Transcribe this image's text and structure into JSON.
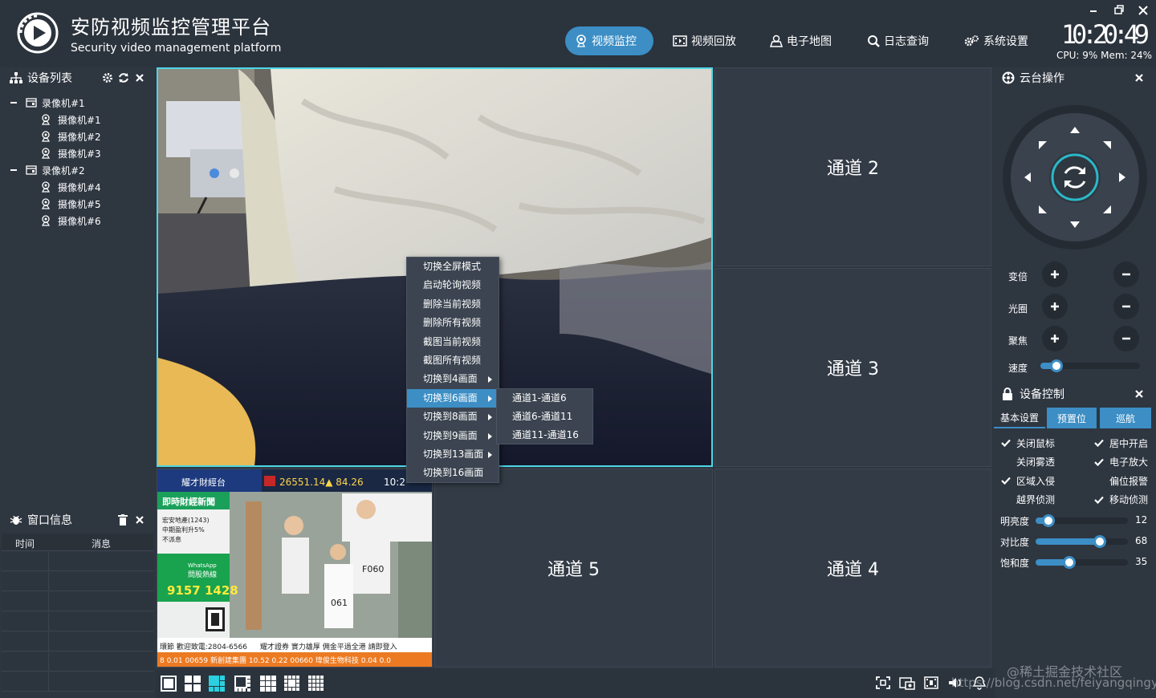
{
  "header": {
    "title": "安防视频监控管理平台",
    "subtitle": "Security video management platform",
    "nav": [
      {
        "label": "视频监控",
        "icon": "camera-icon",
        "active": true
      },
      {
        "label": "视频回放",
        "icon": "film-icon",
        "active": false
      },
      {
        "label": "电子地图",
        "icon": "user-map-icon",
        "active": false
      },
      {
        "label": "日志查询",
        "icon": "search-icon",
        "active": false
      },
      {
        "label": "系统设置",
        "icon": "gears-icon",
        "active": false
      }
    ],
    "clock": "10:20:49",
    "sysinfo": "CPU: 9% Mem: 24%"
  },
  "device_list": {
    "title": "设备列表",
    "tree": [
      {
        "label": "录像机#1",
        "level": 0
      },
      {
        "label": "摄像机#1",
        "level": 1
      },
      {
        "label": "摄像机#2",
        "level": 1
      },
      {
        "label": "摄像机#3",
        "level": 1
      },
      {
        "label": "录像机#2",
        "level": 0
      },
      {
        "label": "摄像机#4",
        "level": 1
      },
      {
        "label": "摄像机#5",
        "level": 1
      },
      {
        "label": "摄像机#6",
        "level": 1
      }
    ]
  },
  "window_info": {
    "title": "窗口信息",
    "columns": [
      "时间",
      "消息"
    ]
  },
  "video_grid": {
    "channels": [
      "通道 2",
      "通道 3",
      "通道 5",
      "通道 4"
    ]
  },
  "context_menu": {
    "items": [
      {
        "label": "切换全屏模式",
        "submenu": false
      },
      {
        "label": "启动轮询视频",
        "submenu": false
      },
      {
        "label": "删除当前视频",
        "submenu": false
      },
      {
        "label": "删除所有视频",
        "submenu": false
      },
      {
        "label": "截图当前视频",
        "submenu": false
      },
      {
        "label": "截图所有视频",
        "submenu": false
      },
      {
        "label": "切换到4画面",
        "submenu": true
      },
      {
        "label": "切换到6画面",
        "submenu": true,
        "highlighted": true
      },
      {
        "label": "切换到8画面",
        "submenu": true
      },
      {
        "label": "切换到9画面",
        "submenu": true
      },
      {
        "label": "切换到13画面",
        "submenu": true
      },
      {
        "label": "切换到16画面",
        "submenu": false
      }
    ],
    "submenu": [
      "通道1-通道6",
      "通道6-通道11",
      "通道11-通道16"
    ]
  },
  "tv_overlay": {
    "brand": "耀才財經台",
    "stock": "26551.14▲ 84.26",
    "time": "10:2",
    "news": "即時財經新聞",
    "line1": "宏安地產(1243)",
    "line2": "中期盈利升5%",
    "line3": "不派息",
    "whatsapp": "WhatsApp",
    "whatsapp2": "問股熱線",
    "hotline": "9157 1428",
    "bib1": "F060",
    "bib2": "061",
    "ticker1": "環節  歡迎致電:2804-6566",
    "ticker2": "耀才證券  實力雄厚  佣金平過全港  請即登入",
    "ticker3": "8  0.01   00659 新創建集團 10.52   0.22   00660 瑋俊生物科技 0.04   0.0"
  },
  "ptz": {
    "title": "云台操作",
    "rows": [
      {
        "label": "变倍"
      },
      {
        "label": "光圈"
      },
      {
        "label": "聚焦"
      }
    ],
    "speed_label": "速度",
    "speed_value": 0.12
  },
  "device_control": {
    "title": "设备控制",
    "tabs": [
      "基本设置",
      "预置位",
      "巡航"
    ],
    "options": [
      {
        "label": "关闭鼠标",
        "checked": true
      },
      {
        "label": "居中开启",
        "checked": true
      },
      {
        "label": "关闭雾透",
        "checked": false
      },
      {
        "label": "电子放大",
        "checked": true
      },
      {
        "label": "区域入侵",
        "checked": true
      },
      {
        "label": "偏位报警",
        "checked": false
      },
      {
        "label": "越界侦测",
        "checked": false
      },
      {
        "label": "移动侦测",
        "checked": true
      }
    ],
    "sliders": [
      {
        "label": "明亮度",
        "value": 12
      },
      {
        "label": "对比度",
        "value": 68
      },
      {
        "label": "饱和度",
        "value": 35
      }
    ]
  },
  "watermark": {
    "line1": "@稀土掘金技术社区",
    "line2": "https://blog.csdn.net/feiyangqingyun"
  },
  "colors": {
    "accent": "#3c8ec5",
    "select": "#4dd7e6",
    "bg": "#2e3640"
  }
}
